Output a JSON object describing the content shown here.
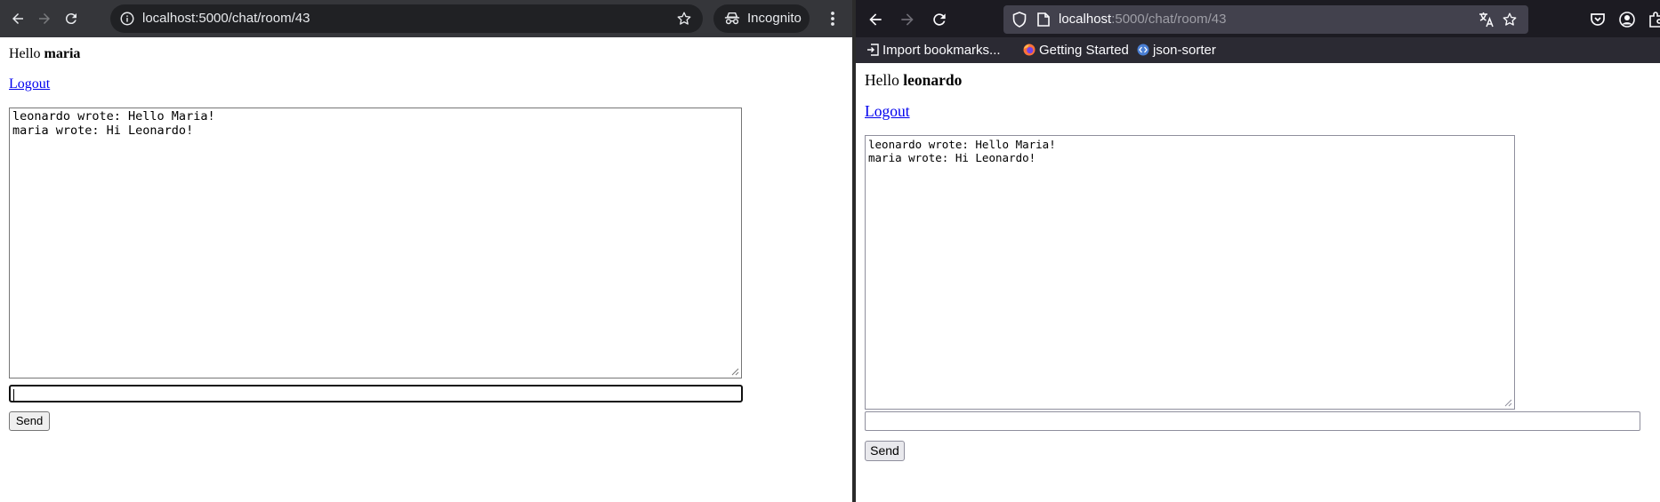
{
  "left_window": {
    "browser": "Chrome",
    "address_bar": {
      "url": "localhost:5000/chat/room/43"
    },
    "incognito_label": "Incognito",
    "page": {
      "greeting_prefix": "Hello ",
      "username": "maria",
      "logout_label": "Logout",
      "chat_log": "leonardo wrote: Hello Maria!\nmaria wrote: Hi Leonardo!",
      "message_input_value": "",
      "send_label": "Send"
    }
  },
  "right_window": {
    "browser": "Firefox",
    "address_bar": {
      "url_host": "localhost",
      "url_rest": ":5000/chat/room/43"
    },
    "bookmarks": [
      {
        "label": "Import bookmarks...",
        "icon": "import-icon"
      },
      {
        "label": "Getting Started",
        "icon": "firefox-icon"
      },
      {
        "label": "json-sorter",
        "icon": "json-sorter-icon"
      }
    ],
    "page": {
      "greeting_prefix": "Hello ",
      "username": "leonardo",
      "logout_label": "Logout",
      "chat_log": "leonardo wrote: Hello Maria!\nmaria wrote: Hi Leonardo!",
      "message_input_value": "",
      "send_label": "Send"
    }
  },
  "colors": {
    "chrome_toolbar": "#35363a",
    "chrome_omnibox": "#202124",
    "firefox_toolbar": "#1c1b22",
    "firefox_bookmarks_bar": "#2b2a33",
    "firefox_urlbar": "#42414d",
    "link": "#0000ee"
  }
}
